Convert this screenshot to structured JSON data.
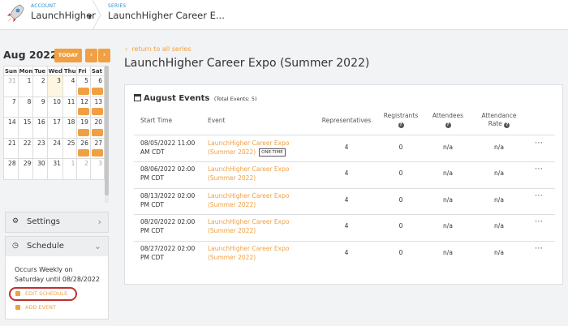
{
  "header": {
    "account_label": "ACCOUNT",
    "account_name": "LaunchHigher",
    "series_label": "SERIES",
    "series_name": "LaunchHigher Career E..."
  },
  "calendar": {
    "month_title": "Aug 2022",
    "today_label": "TODAY",
    "prev_icon": "chevron-left",
    "next_icon": "chevron-right",
    "weekdays": [
      "Sun",
      "Mon",
      "Tue",
      "Wed",
      "Thu",
      "Fri",
      "Sat"
    ],
    "weeks": [
      [
        "31",
        "1",
        "2",
        "3",
        "4",
        "5",
        "6"
      ],
      [
        "7",
        "8",
        "9",
        "10",
        "11",
        "12",
        "13"
      ],
      [
        "14",
        "15",
        "16",
        "17",
        "18",
        "19",
        "20"
      ],
      [
        "21",
        "22",
        "23",
        "24",
        "25",
        "26",
        "27"
      ],
      [
        "28",
        "29",
        "30",
        "31",
        "1",
        "2",
        "3"
      ]
    ],
    "event_days": [
      "5",
      "6",
      "12",
      "13",
      "19",
      "20",
      "26",
      "27"
    ],
    "today_day": "3"
  },
  "sidebar": {
    "settings_label": "Settings",
    "schedule_label": "Schedule",
    "schedule_text": "Occurs Weekly on Saturday until 08/28/2022",
    "edit_schedule_label": "EDIT SCHEDULE",
    "add_event_label": "ADD EVENT"
  },
  "main": {
    "back_link": "return to all series",
    "title": "LaunchHigher Career Expo (Summer 2022)",
    "card_title": "August Events",
    "total_events": "(Total Events: 5)",
    "columns": {
      "start_time": "Start Time",
      "event": "Event",
      "representatives": "Representatives",
      "registrants": "Registrants",
      "attendees": "Attendees",
      "attendance_rate_1": "Attendance",
      "attendance_rate_2": "Rate"
    },
    "rows": [
      {
        "start_1": "08/05/2022 11:00",
        "start_2": "AM CDT",
        "event_1": "LaunchHigher Career Expo",
        "event_2": "(Summer 2022)",
        "badge": "ONE-TIME",
        "reps": "4",
        "registrants": "0",
        "attendees": "n/a",
        "rate": "n/a"
      },
      {
        "start_1": "08/06/2022 02:00",
        "start_2": "PM CDT",
        "event_1": "LaunchHigher Career Expo",
        "event_2": "(Summer 2022)",
        "badge": "",
        "reps": "4",
        "registrants": "0",
        "attendees": "n/a",
        "rate": "n/a"
      },
      {
        "start_1": "08/13/2022 02:00",
        "start_2": "PM CDT",
        "event_1": "LaunchHigher Career Expo",
        "event_2": "(Summer 2022)",
        "badge": "",
        "reps": "4",
        "registrants": "0",
        "attendees": "n/a",
        "rate": "n/a"
      },
      {
        "start_1": "08/20/2022 02:00",
        "start_2": "PM CDT",
        "event_1": "LaunchHigher Career Expo",
        "event_2": "(Summer 2022)",
        "badge": "",
        "reps": "4",
        "registrants": "0",
        "attendees": "n/a",
        "rate": "n/a"
      },
      {
        "start_1": "08/27/2022 02:00",
        "start_2": "PM CDT",
        "event_1": "LaunchHigher Career Expo",
        "event_2": "(Summer 2022)",
        "badge": "",
        "reps": "4",
        "registrants": "0",
        "attendees": "n/a",
        "rate": "n/a"
      }
    ]
  },
  "colors": {
    "accent": "#f0a042",
    "link_blue": "#2b8fd6",
    "highlight_circle": "#c0302d"
  }
}
